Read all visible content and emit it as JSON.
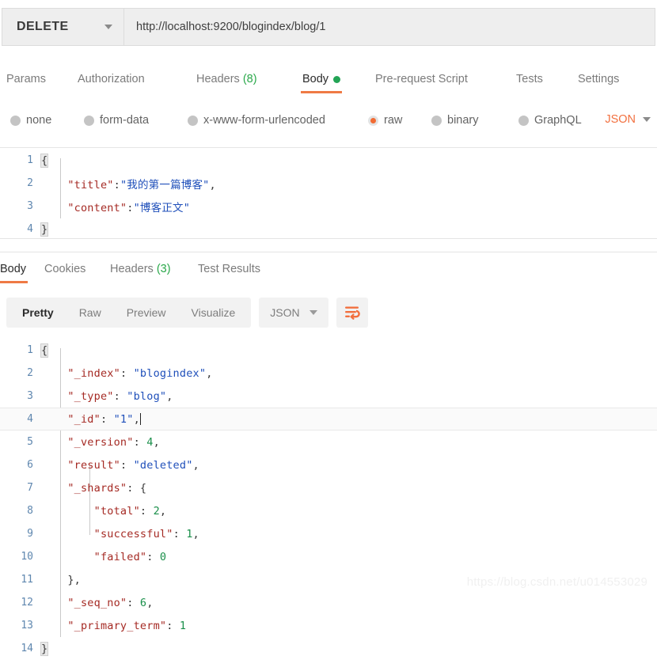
{
  "request": {
    "method": "DELETE",
    "url": "http://localhost:9200/blogindex/blog/1",
    "tabs": [
      {
        "label": "Params",
        "count": null,
        "active": false
      },
      {
        "label": "Authorization",
        "count": null,
        "active": false
      },
      {
        "label": "Headers",
        "count": "(8)",
        "active": false
      },
      {
        "label": "Body",
        "count": null,
        "active": true
      },
      {
        "label": "Pre-request Script",
        "count": null,
        "active": false
      },
      {
        "label": "Tests",
        "count": null,
        "active": false
      },
      {
        "label": "Settings",
        "count": null,
        "active": false
      }
    ],
    "body_types": [
      {
        "label": "none",
        "selected": false
      },
      {
        "label": "form-data",
        "selected": false
      },
      {
        "label": "x-www-form-urlencoded",
        "selected": false
      },
      {
        "label": "raw",
        "selected": true
      },
      {
        "label": "binary",
        "selected": false
      },
      {
        "label": "GraphQL",
        "selected": false
      }
    ],
    "raw_format": "JSON",
    "body_lines": [
      {
        "n": "1",
        "text": "{"
      },
      {
        "n": "2",
        "text": "    \"title\":\"我的第一篇博客\","
      },
      {
        "n": "3",
        "text": "    \"content\":\"博客正文\""
      },
      {
        "n": "4",
        "text": "}"
      }
    ]
  },
  "response": {
    "tabs": [
      {
        "label": "Body",
        "count": null,
        "active": true
      },
      {
        "label": "Cookies",
        "count": null,
        "active": false
      },
      {
        "label": "Headers",
        "count": "(3)",
        "active": false
      },
      {
        "label": "Test Results",
        "count": null,
        "active": false
      }
    ],
    "view_modes": [
      {
        "label": "Pretty",
        "active": true
      },
      {
        "label": "Raw",
        "active": false
      },
      {
        "label": "Preview",
        "active": false
      },
      {
        "label": "Visualize",
        "active": false
      }
    ],
    "format": "JSON",
    "wrap_icon": "word-wrap-icon",
    "body_lines": [
      {
        "n": "1",
        "text": "{"
      },
      {
        "n": "2",
        "text": "    \"_index\": \"blogindex\","
      },
      {
        "n": "3",
        "text": "    \"_type\": \"blog\","
      },
      {
        "n": "4",
        "text": "    \"_id\": \"1\","
      },
      {
        "n": "5",
        "text": "    \"_version\": 4,"
      },
      {
        "n": "6",
        "text": "    \"result\": \"deleted\","
      },
      {
        "n": "7",
        "text": "    \"_shards\": {"
      },
      {
        "n": "8",
        "text": "        \"total\": 2,"
      },
      {
        "n": "9",
        "text": "        \"successful\": 1,"
      },
      {
        "n": "10",
        "text": "        \"failed\": 0"
      },
      {
        "n": "11",
        "text": "    },"
      },
      {
        "n": "12",
        "text": "    \"_seq_no\": 6,"
      },
      {
        "n": "13",
        "text": "    \"_primary_term\": 1"
      },
      {
        "n": "14",
        "text": "}"
      }
    ],
    "parsed_body": {
      "_index": "blogindex",
      "_type": "blog",
      "_id": "1",
      "_version": 4,
      "result": "deleted",
      "_shards": {
        "total": 2,
        "successful": 1,
        "failed": 0
      },
      "_seq_no": 6,
      "_primary_term": 1
    }
  },
  "watermark": "https://blog.csdn.net/u014553029",
  "colors": {
    "accent_orange": "#ef7a45",
    "radio_orange": "#f26b33",
    "green_badge": "#2aa84a",
    "json_key": "#a52a24",
    "json_string": "#1f4fba",
    "json_number": "#1a8f4a",
    "line_number": "#5f87af"
  }
}
